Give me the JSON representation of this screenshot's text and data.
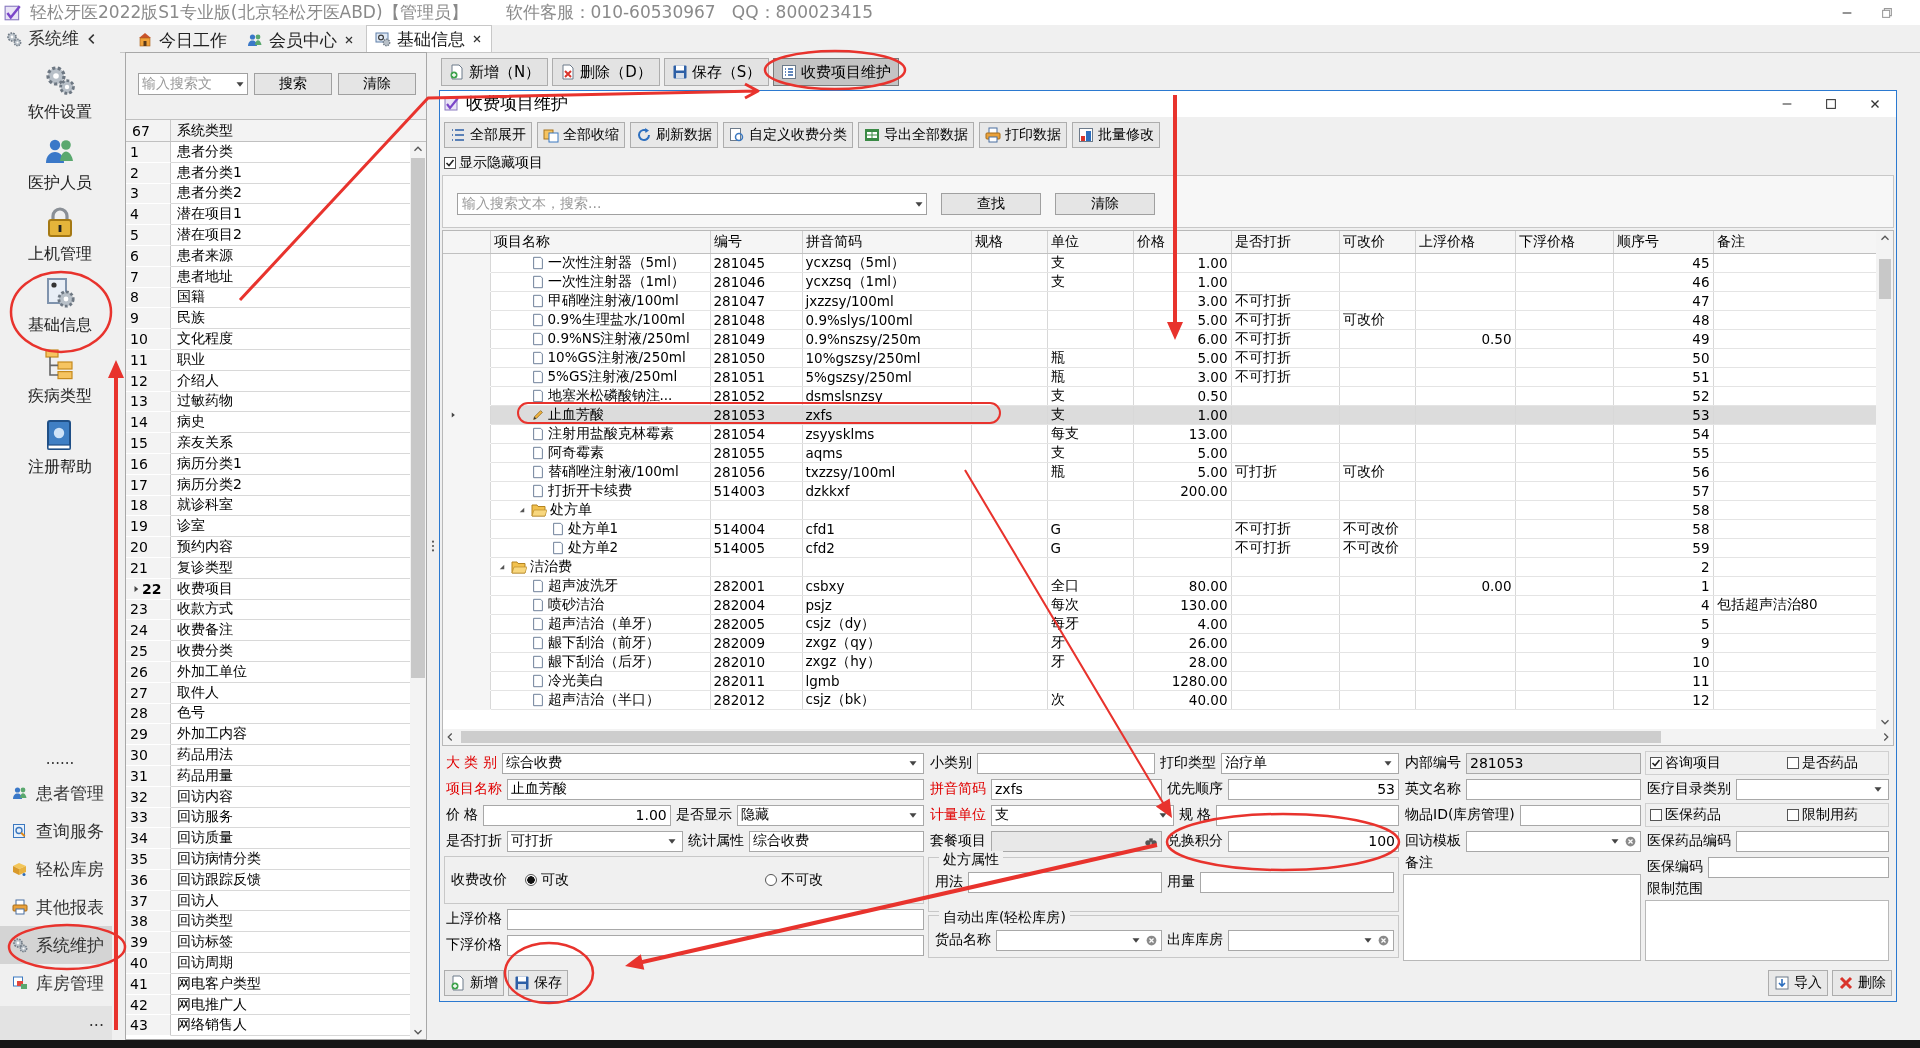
{
  "window": {
    "title": "轻松牙医2022版S1专业版(北京轻松牙医ABD)【管理员】",
    "support": "软件客服：010-60530967   QQ：800023415"
  },
  "sidebar": {
    "title": "系统维",
    "top_items": [
      {
        "label": "软件设置",
        "selected": false
      },
      {
        "label": "医护人员",
        "selected": false
      },
      {
        "label": "上机管理",
        "selected": false
      },
      {
        "label": "基础信息",
        "selected": false
      },
      {
        "label": "疾病类型",
        "selected": false
      },
      {
        "label": "注册帮助",
        "selected": false
      }
    ],
    "more_top": "......",
    "bottom_items": [
      {
        "label": "患者管理",
        "selected": false
      },
      {
        "label": "查询服务",
        "selected": false
      },
      {
        "label": "轻松库房",
        "selected": false
      },
      {
        "label": "其他报表",
        "selected": false
      },
      {
        "label": "系统维护",
        "selected": true
      },
      {
        "label": "库房管理",
        "selected": false
      }
    ],
    "more_bottom": "..."
  },
  "tabs": [
    {
      "label": "今日工作",
      "selected": false,
      "closable": false
    },
    {
      "label": "会员中心",
      "selected": false,
      "closable": true
    },
    {
      "label": "基础信息",
      "selected": true,
      "closable": true
    }
  ],
  "type_list": {
    "search_placeholder": "输入搜索文",
    "search_button": "搜索",
    "clear_button": "清除",
    "count": "67",
    "column": "系统类型",
    "rows": [
      {
        "no": "1",
        "name": "患者分类",
        "selected": false
      },
      {
        "no": "2",
        "name": "患者分类1",
        "selected": false
      },
      {
        "no": "3",
        "name": "患者分类2",
        "selected": false
      },
      {
        "no": "4",
        "name": "潜在项目1",
        "selected": false
      },
      {
        "no": "5",
        "name": "潜在项目2",
        "selected": false
      },
      {
        "no": "6",
        "name": "患者来源",
        "selected": false
      },
      {
        "no": "7",
        "name": "患者地址",
        "selected": false
      },
      {
        "no": "8",
        "name": "国籍",
        "selected": false
      },
      {
        "no": "9",
        "name": "民族",
        "selected": false
      },
      {
        "no": "10",
        "name": "文化程度",
        "selected": false
      },
      {
        "no": "11",
        "name": "职业",
        "selected": false
      },
      {
        "no": "12",
        "name": "介绍人",
        "selected": false
      },
      {
        "no": "13",
        "name": "过敏药物",
        "selected": false
      },
      {
        "no": "14",
        "name": "病史",
        "selected": false
      },
      {
        "no": "15",
        "name": "亲友关系",
        "selected": false
      },
      {
        "no": "16",
        "name": "病历分类1",
        "selected": false
      },
      {
        "no": "17",
        "name": "病历分类2",
        "selected": false
      },
      {
        "no": "18",
        "name": "就诊科室",
        "selected": false
      },
      {
        "no": "19",
        "name": "诊室",
        "selected": false
      },
      {
        "no": "20",
        "name": "预约内容",
        "selected": false
      },
      {
        "no": "21",
        "name": "复诊类型",
        "selected": false
      },
      {
        "no": "22",
        "name": "收费项目",
        "selected": true
      },
      {
        "no": "23",
        "name": "收款方式",
        "selected": false
      },
      {
        "no": "24",
        "name": "收费备注",
        "selected": false
      },
      {
        "no": "25",
        "name": "收费分类",
        "selected": false
      },
      {
        "no": "26",
        "name": "外加工单位",
        "selected": false
      },
      {
        "no": "27",
        "name": "取件人",
        "selected": false
      },
      {
        "no": "28",
        "name": "色号",
        "selected": false
      },
      {
        "no": "29",
        "name": "外加工内容",
        "selected": false
      },
      {
        "no": "30",
        "name": "药品用法",
        "selected": false
      },
      {
        "no": "31",
        "name": "药品用量",
        "selected": false
      },
      {
        "no": "32",
        "name": "回访内容",
        "selected": false
      },
      {
        "no": "33",
        "name": "回访服务",
        "selected": false
      },
      {
        "no": "34",
        "name": "回访质量",
        "selected": false
      },
      {
        "no": "35",
        "name": "回访病情分类",
        "selected": false
      },
      {
        "no": "36",
        "name": "回访跟踪反馈",
        "selected": false
      },
      {
        "no": "37",
        "name": "回访人",
        "selected": false
      },
      {
        "no": "38",
        "name": "回访类型",
        "selected": false
      },
      {
        "no": "39",
        "name": "回访标签",
        "selected": false
      },
      {
        "no": "40",
        "name": "回访周期",
        "selected": false
      },
      {
        "no": "41",
        "name": "网电客户类型",
        "selected": false
      },
      {
        "no": "42",
        "name": "网电推广人",
        "selected": false
      },
      {
        "no": "43",
        "name": "网络销售人",
        "selected": false
      }
    ]
  },
  "toolbar": [
    {
      "label": "新增（N）",
      "selected": false
    },
    {
      "label": "删除（D）",
      "selected": false
    },
    {
      "label": "保存（S）",
      "selected": false
    },
    {
      "label": "收费项目维护",
      "selected": true
    }
  ],
  "dialog": {
    "title": "收费项目维护",
    "toolbar": [
      "全部展开",
      "全部收缩",
      "刷新数据",
      "自定义收费分类",
      "导出全部数据",
      "打印数据",
      "批量修改"
    ],
    "show_hidden": {
      "label": "显示隐藏项目",
      "checked": true
    },
    "search": {
      "placeholder": "输入搜索文本，搜索...",
      "find": "查找",
      "clear": "清除"
    },
    "table": {
      "columns": [
        "项目名称",
        "编号",
        "拼音简码",
        "规格",
        "单位",
        "价格",
        "是否打折",
        "可改价",
        "上浮价格",
        "下浮价格",
        "顺序号",
        "备注"
      ],
      "rows": [
        {
          "kind": "continued",
          "children": [
            {
              "kind": "item",
              "name": "一次性注射器（5ml）",
              "code": "281045",
              "pinyin": "ycxzsq（5ml）",
              "unit": "支",
              "price": "1.00",
              "seq": "45",
              "selected": false
            },
            {
              "kind": "item",
              "name": "一次性注射器（1ml）",
              "code": "281046",
              "pinyin": "ycxzsq（1ml）",
              "unit": "支",
              "price": "1.00",
              "seq": "46",
              "selected": false
            },
            {
              "kind": "item",
              "name": "甲硝唑注射液/100ml",
              "code": "281047",
              "pinyin": "jxzzsy/100ml",
              "price": "3.00",
              "discount": "不可打折",
              "seq": "47",
              "selected": false
            },
            {
              "kind": "item",
              "name": "0.9%生理盐水/100ml",
              "code": "281048",
              "pinyin": "0.9%slys/100ml",
              "price": "5.00",
              "discount": "不可打折",
              "price_change": "可改价",
              "seq": "48",
              "selected": false
            },
            {
              "kind": "item",
              "name": "0.9%NS注射液/250ml",
              "code": "281049",
              "pinyin": "0.9%nszsy/250m",
              "price": "6.00",
              "discount": "不可打折",
              "up_price": "0.50",
              "seq": "49",
              "selected": false
            },
            {
              "kind": "item",
              "name": "10%GS注射液/250ml",
              "code": "281050",
              "pinyin": "10%gszsy/250ml",
              "unit": "瓶",
              "price": "5.00",
              "discount": "不可打折",
              "seq": "50",
              "selected": false
            },
            {
              "kind": "item",
              "name": "5%GS注射液/250ml",
              "code": "281051",
              "pinyin": "5%gszsy/250ml",
              "unit": "瓶",
              "price": "3.00",
              "discount": "不可打折",
              "seq": "51",
              "selected": false
            },
            {
              "kind": "item",
              "name": "地塞米松磷酸钠注...",
              "code": "281052",
              "pinyin": "dsmslsnzsy",
              "unit": "支",
              "price": "0.50",
              "seq": "52",
              "selected": false
            },
            {
              "kind": "item",
              "name": "止血芳酸",
              "code": "281053",
              "pinyin": "zxfs",
              "unit": "支",
              "price": "1.00",
              "seq": "53",
              "selected": true
            },
            {
              "kind": "item",
              "name": "注射用盐酸克林霉素",
              "code": "281054",
              "pinyin": "zsyysklms",
              "unit": "每支",
              "price": "13.00",
              "seq": "54",
              "selected": false
            },
            {
              "kind": "item",
              "name": "阿奇霉素",
              "code": "281055",
              "pinyin": "aqms",
              "unit": "支",
              "price": "5.00",
              "seq": "55",
              "selected": false
            },
            {
              "kind": "item",
              "name": "替硝唑注射液/100ml",
              "code": "281056",
              "pinyin": "txzzsy/100ml",
              "unit": "瓶",
              "price": "5.00",
              "discount": "可打折",
              "price_change": "可改价",
              "seq": "56",
              "selected": false
            },
            {
              "kind": "item",
              "name": "打折开卡续费",
              "code": "514003",
              "pinyin": "dzkkxf",
              "price": "200.00",
              "seq": "57",
              "selected": false
            },
            {
              "kind": "folder",
              "name": "处方单",
              "seq": "58",
              "expanded": true,
              "selected": false,
              "children": [
                {
                  "kind": "item",
                  "name": "处方单1",
                  "code": "514004",
                  "pinyin": "cfd1",
                  "unit": "G",
                  "discount": "不可打折",
                  "price_change": "不可改价",
                  "seq": "58",
                  "selected": false
                },
                {
                  "kind": "item",
                  "name": "处方单2",
                  "code": "514005",
                  "pinyin": "cfd2",
                  "unit": "G",
                  "discount": "不可打折",
                  "price_change": "不可改价",
                  "seq": "59",
                  "selected": false
                }
              ]
            }
          ]
        },
        {
          "kind": "folder",
          "name": "洁治费",
          "seq": "2",
          "expanded": true,
          "selected": false,
          "children": [
            {
              "kind": "item",
              "name": "超声波洗牙",
              "code": "282001",
              "pinyin": "csbxy",
              "unit": "全口",
              "price": "80.00",
              "up_price": "0.00",
              "seq": "1",
              "selected": false
            },
            {
              "kind": "item",
              "name": "喷砂洁治",
              "code": "282004",
              "pinyin": "psjz",
              "unit": "每次",
              "price": "130.00",
              "seq": "4",
              "note": "包括超声洁治80",
              "selected": false
            },
            {
              "kind": "item",
              "name": "超声洁治（单牙）",
              "code": "282005",
              "pinyin": "csjz（dy）",
              "unit": "每牙",
              "price": "4.00",
              "seq": "5",
              "selected": false
            },
            {
              "kind": "item",
              "name": "龈下刮治（前牙）",
              "code": "282009",
              "pinyin": "zxgz（qy）",
              "unit": "牙",
              "price": "26.00",
              "seq": "9",
              "selected": false
            },
            {
              "kind": "item",
              "name": "龈下刮治（后牙）",
              "code": "282010",
              "pinyin": "zxgz（hy）",
              "unit": "牙",
              "price": "28.00",
              "seq": "10",
              "selected": false
            },
            {
              "kind": "item",
              "name": "冷光美白",
              "code": "282011",
              "pinyin": "lgmb",
              "price": "1280.00",
              "seq": "11",
              "selected": false
            },
            {
              "kind": "item",
              "name": "超声洁治（半口）",
              "code": "282012",
              "pinyin": "csjz（bk）",
              "unit": "次",
              "price": "40.00",
              "seq": "12",
              "selected": false
            }
          ]
        }
      ]
    },
    "form": {
      "columns": [
        [
          [
            {
              "kind": "select",
              "label": "大 类 别",
              "value": "综合收费",
              "required": true
            }
          ],
          [
            {
              "kind": "text",
              "label": "项目名称",
              "value": "止血芳酸",
              "required": true
            }
          ],
          [
            {
              "kind": "number",
              "label": "价 格",
              "value": "1.00",
              "required": false
            },
            {
              "kind": "select",
              "label": "是否显示",
              "value": "隐藏",
              "required": false
            }
          ],
          [
            {
              "kind": "select",
              "label": "是否打折",
              "value": "可打折",
              "required": false
            },
            {
              "kind": "text",
              "label": "统计属性",
              "value": "综合收费",
              "required": false
            }
          ],
          [
            {
              "kind": "radio-group",
              "label": "收费改价",
              "options": [
                {
                  "label": "可改",
                  "selected": true
                },
                {
                  "label": "不可改",
                  "selected": false
                }
              ]
            }
          ],
          [
            {
              "kind": "text",
              "label": "上浮价格",
              "required": false
            }
          ],
          [
            {
              "kind": "text",
              "label": "下浮价格",
              "required": false
            }
          ]
        ],
        [
          [
            {
              "kind": "text",
              "label": "小类别",
              "required": false
            },
            {
              "kind": "select",
              "label": "打印类型",
              "value": "治疗单",
              "required": false
            }
          ],
          [
            {
              "kind": "text",
              "label": "拼音简码",
              "value": "zxfs",
              "required": true
            },
            {
              "kind": "number",
              "label": "优先顺序",
              "value": "53",
              "required": false
            }
          ],
          [
            {
              "kind": "select",
              "label": "计量单位",
              "value": "支",
              "required": true
            },
            {
              "kind": "text",
              "label": "规 格",
              "required": false
            }
          ],
          [
            {
              "kind": "lookup",
              "label": "套餐项目",
              "required": false
            },
            {
              "kind": "number",
              "label": "兑换积分",
              "value": "100",
              "required": false
            }
          ],
          [
            {
              "kind": "group",
              "title": "处方属性",
              "fields": [
                {
                  "kind": "text",
                  "label": "用法",
                  "required": false
                },
                {
                  "kind": "text",
                  "label": "用量",
                  "required": false
                }
              ]
            }
          ],
          [
            {
              "kind": "group",
              "title": "自动出库(轻松库房)",
              "fields": [
                {
                  "kind": "select-clear",
                  "label": "货品名称",
                  "required": false
                },
                {
                  "kind": "select-clear",
                  "label": "出库库房",
                  "required": false
                }
              ]
            }
          ]
        ],
        [
          [
            {
              "kind": "readonly",
              "label": "内部编号",
              "value": "281053",
              "required": false
            }
          ],
          [
            {
              "kind": "text",
              "label": "英文名称",
              "required": false
            }
          ],
          [
            {
              "kind": "text",
              "label": "物品ID(库房管理)",
              "required": false
            }
          ],
          [
            {
              "kind": "select-clear",
              "label": "回访模板",
              "required": false
            }
          ],
          [
            {
              "kind": "memo",
              "label": "备注"
            }
          ]
        ],
        [
          [
            {
              "kind": "checkbox",
              "label": "咨询项目",
              "checked": true
            },
            {
              "kind": "checkbox",
              "label": "是否药品",
              "checked": false
            }
          ],
          [
            {
              "kind": "select",
              "label": "医疗目录类别",
              "required": false
            }
          ],
          [
            {
              "kind": "checkbox",
              "label": "医保药品",
              "checked": false
            },
            {
              "kind": "checkbox",
              "label": "限制用药",
              "checked": false
            }
          ],
          [
            {
              "kind": "text",
              "label": "医保药品编码",
              "required": false
            }
          ],
          [
            {
              "kind": "text",
              "label": "医保编码",
              "required": false
            }
          ],
          [
            {
              "kind": "memo",
              "label": "限制范围"
            }
          ]
        ]
      ]
    },
    "buttons_left": [
      "新增",
      "保存"
    ],
    "buttons_right": [
      "导入",
      "删除"
    ]
  }
}
